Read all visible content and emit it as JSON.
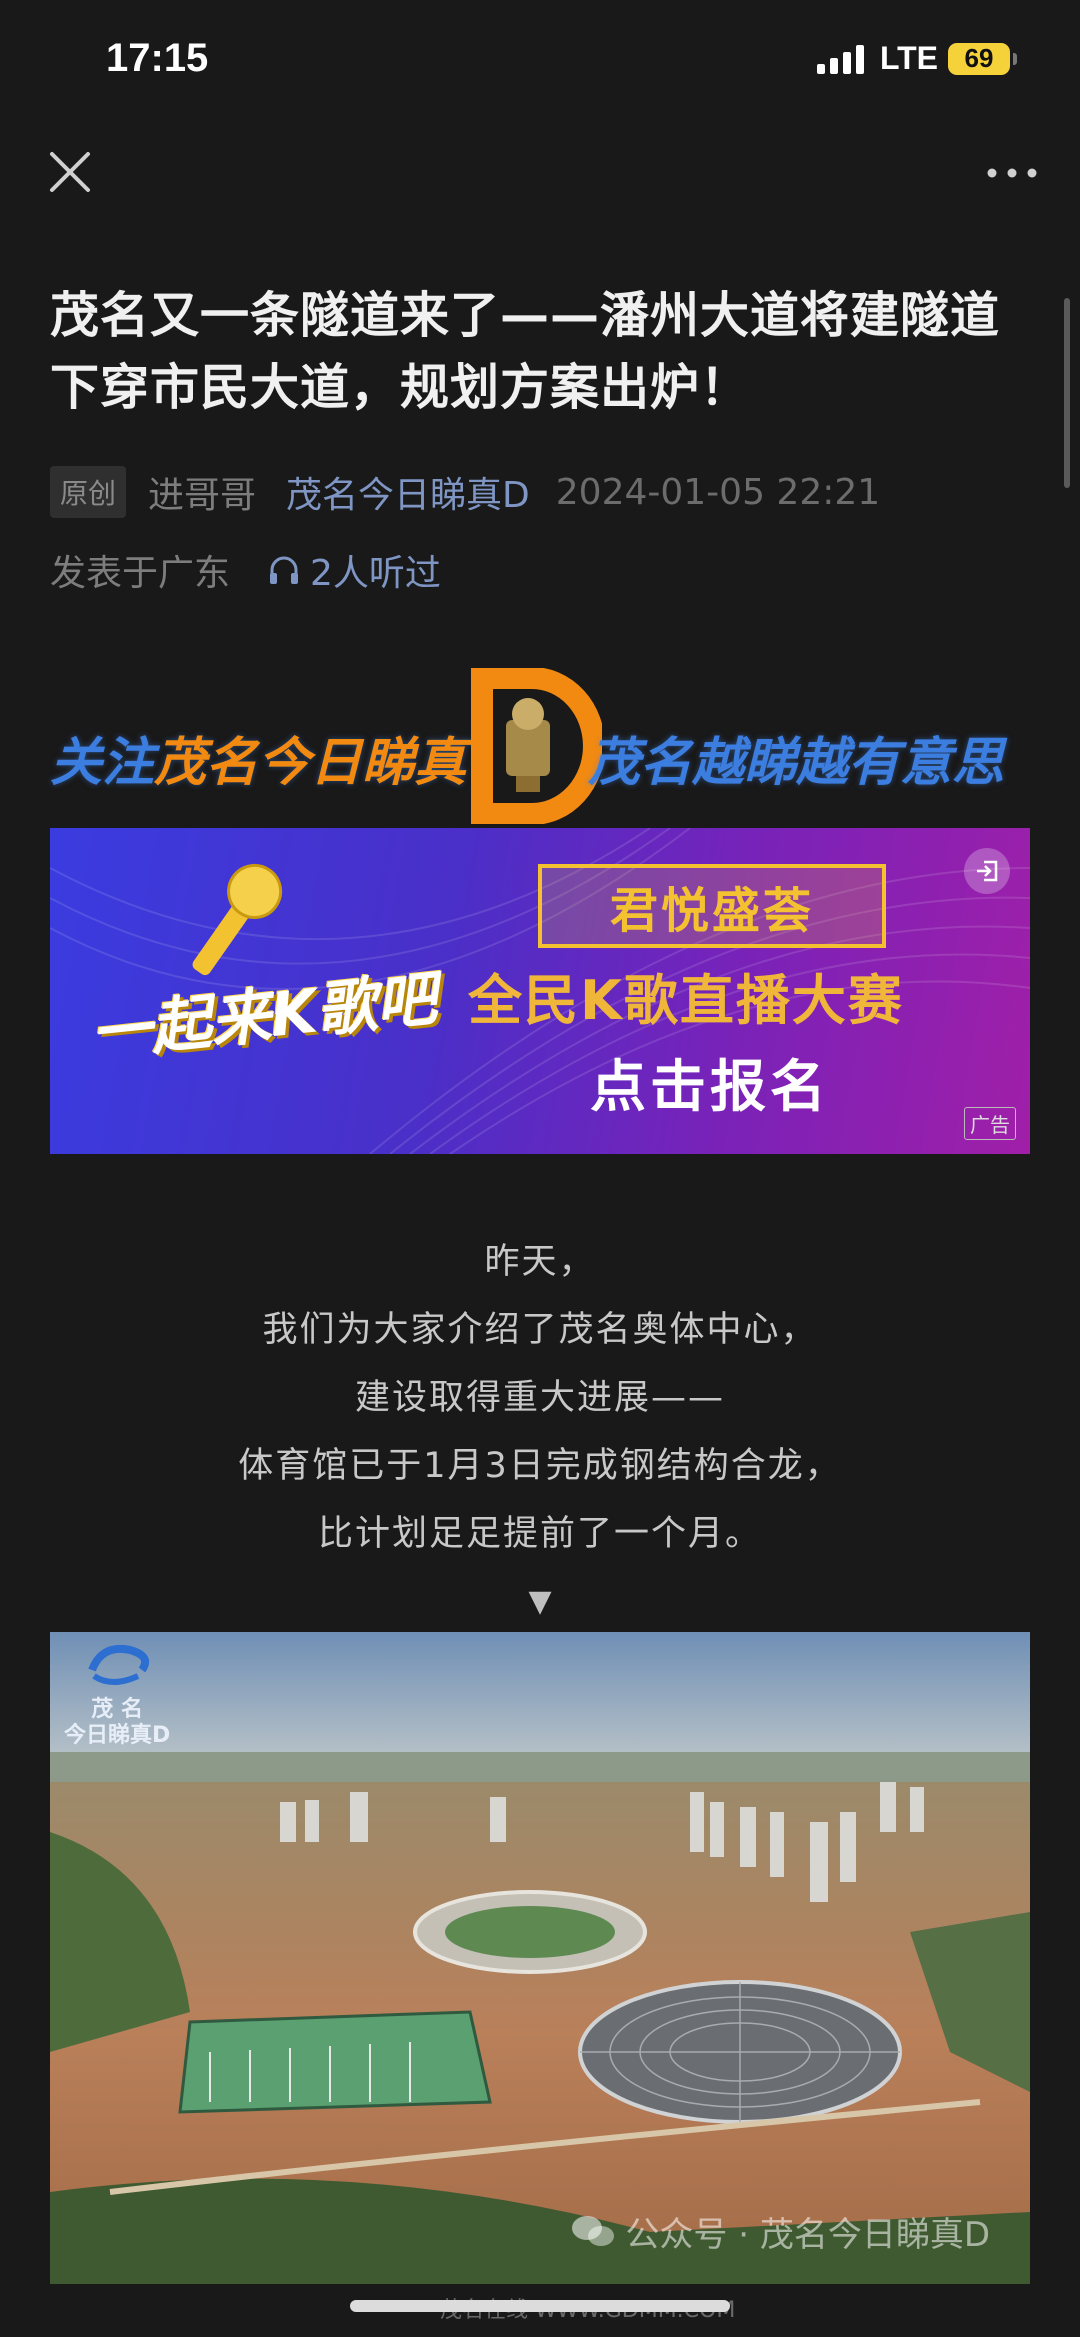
{
  "status": {
    "time": "17:15",
    "network": "LTE",
    "battery": "69"
  },
  "article": {
    "title": "茂名又一条隧道来了——潘州大道将建隧道下穿市民大道，规划方案出炉！",
    "badge": "原创",
    "author": "进哥哥",
    "account": "茂名今日睇真D",
    "date": "2024-01-05 22:21",
    "location": "发表于广东",
    "listeners": "2人听过"
  },
  "follow_banner": {
    "left_prefix": "关注",
    "left_highlight": "茂名今日睇真",
    "logo_letter": "D",
    "right_text": "茂名越睇越有意思"
  },
  "ad": {
    "slogan": "一起来K歌吧",
    "brand": "君悦盛荟",
    "line2": "全民K歌直播大赛",
    "line3": "点击报名",
    "tag": "广告"
  },
  "body": {
    "lines": [
      "昨天，",
      "我们为大家介绍了茂名奥体中心，",
      "建设取得重大进展——",
      "体育馆已于1月3日完成钢结构合龙，",
      "比计划足足提前了一个月。"
    ],
    "arrow": "▼"
  },
  "photo": {
    "logo_line1": "茂 名",
    "logo_line2": "今日睇真D",
    "watermark": "公众号 · 茂名今日睇真D"
  },
  "footer_watermark": "茂名在线 WWW.GDMM.COM",
  "colors": {
    "background": "#191919",
    "link": "#7f96c4",
    "accent_orange": "#f28a12",
    "accent_blue": "#3c7de0"
  }
}
